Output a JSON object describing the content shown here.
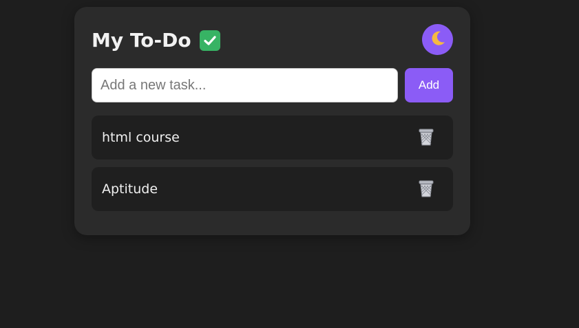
{
  "app": {
    "title": "My To-Do",
    "title_icon": "check-mark-button-icon",
    "theme_toggle_icon": "crescent-moon-icon"
  },
  "input": {
    "placeholder": "Add a new task...",
    "value": ""
  },
  "add_button": {
    "label": "Add"
  },
  "tasks": [
    {
      "text": "html course",
      "delete_icon": "wastebasket-icon"
    },
    {
      "text": "Aptitude",
      "delete_icon": "wastebasket-icon"
    }
  ],
  "colors": {
    "background": "#1e1e1e",
    "card": "#2b2b2b",
    "task_item": "#1f1f1f",
    "accent": "#8b5cf6",
    "check_green": "#37b364",
    "text": "#f0f0f0"
  }
}
